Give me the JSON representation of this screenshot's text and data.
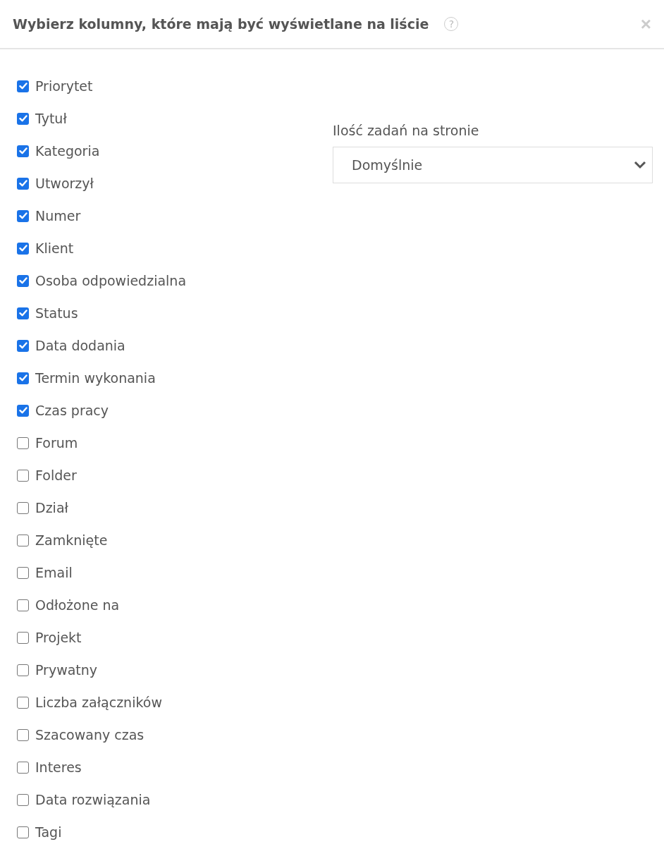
{
  "dialog": {
    "title": "Wybierz kolumny, które mają być wyświetlane na liście",
    "help": "?",
    "close": "×"
  },
  "columns": [
    {
      "label": "Priorytet",
      "checked": true
    },
    {
      "label": "Tytuł",
      "checked": true
    },
    {
      "label": "Kategoria",
      "checked": true
    },
    {
      "label": "Utworzył",
      "checked": true
    },
    {
      "label": "Numer",
      "checked": true
    },
    {
      "label": "Klient",
      "checked": true
    },
    {
      "label": "Osoba odpowiedzialna",
      "checked": true
    },
    {
      "label": "Status",
      "checked": true
    },
    {
      "label": "Data dodania",
      "checked": true
    },
    {
      "label": "Termin wykonania",
      "checked": true
    },
    {
      "label": "Czas pracy",
      "checked": true
    },
    {
      "label": "Forum",
      "checked": false
    },
    {
      "label": "Folder",
      "checked": false
    },
    {
      "label": "Dział",
      "checked": false
    },
    {
      "label": "Zamknięte",
      "checked": false
    },
    {
      "label": "Email",
      "checked": false
    },
    {
      "label": "Odłożone na",
      "checked": false
    },
    {
      "label": "Projekt",
      "checked": false
    },
    {
      "label": "Prywatny",
      "checked": false
    },
    {
      "label": "Liczba załączników",
      "checked": false
    },
    {
      "label": "Szacowany czas",
      "checked": false
    },
    {
      "label": "Interes",
      "checked": false
    },
    {
      "label": "Data rozwiązania",
      "checked": false
    },
    {
      "label": "Tagi",
      "checked": false
    }
  ],
  "per_page": {
    "label": "Ilość zadań na stronie",
    "value": "Domyślnie"
  }
}
